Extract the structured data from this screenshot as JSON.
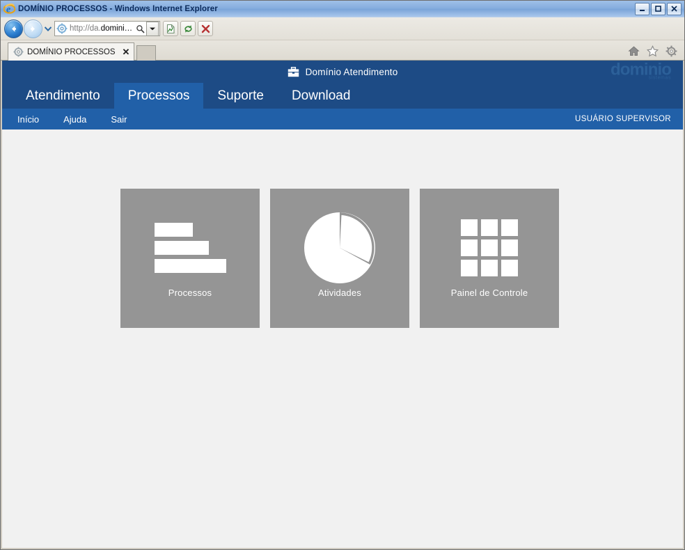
{
  "browser": {
    "title": "DOMÍNIO PROCESSOS - Windows Internet Explorer",
    "app_icon": "internet-explorer-icon",
    "window_controls": {
      "minimize": "_",
      "maximize": "❐",
      "close": "✕"
    },
    "nav": {
      "back": "back-arrow",
      "forward": "forward-arrow",
      "recent_pages": "chevron-down-icon"
    },
    "address": {
      "icon": "page-gear-icon",
      "scheme_host_dim": "http://da.",
      "value": "domini…",
      "full_value": "http://da.domini…",
      "search_icon": "search-icon",
      "dropdown_icon": "chevron-down-icon"
    },
    "toolbar_buttons": [
      {
        "name": "compatibility-view-button",
        "icon": "broken-page-icon"
      },
      {
        "name": "refresh-button",
        "icon": "refresh-icon"
      },
      {
        "name": "stop-button",
        "icon": "close-x-icon"
      }
    ],
    "tabs": [
      {
        "label": "DOMÍNIO PROCESSOS",
        "icon": "page-gear-icon",
        "close": "✕",
        "active": true
      }
    ],
    "new_tab_label": "",
    "command_icons": [
      {
        "name": "home-icon",
        "glyph": "home"
      },
      {
        "name": "favorites-icon",
        "glyph": "star"
      },
      {
        "name": "tools-icon",
        "glyph": "gear"
      }
    ]
  },
  "page": {
    "header": {
      "icon": "briefcase-icon",
      "title": "Domínio Atendimento",
      "brand": "dominio",
      "brand_sub": "sistemas"
    },
    "main_nav": [
      {
        "label": "Atendimento",
        "active": false
      },
      {
        "label": "Processos",
        "active": true
      },
      {
        "label": "Suporte",
        "active": false
      },
      {
        "label": "Download",
        "active": false
      }
    ],
    "sub_nav": [
      {
        "label": "Início"
      },
      {
        "label": "Ajuda"
      },
      {
        "label": "Sair"
      }
    ],
    "user": "USUÁRIO SUPERVISOR",
    "tiles": [
      {
        "label": "Processos",
        "icon": "bar-chart-icon"
      },
      {
        "label": "Atividades",
        "icon": "pie-chart-icon"
      },
      {
        "label": "Painel de Controle",
        "icon": "grid-icon"
      }
    ],
    "colors": {
      "header_blue": "#1d4b85",
      "nav_active_blue": "#2160a8",
      "page_background": "#f1f1f1",
      "tile_gray": "#959595",
      "tile_text": "#ffffff"
    }
  }
}
